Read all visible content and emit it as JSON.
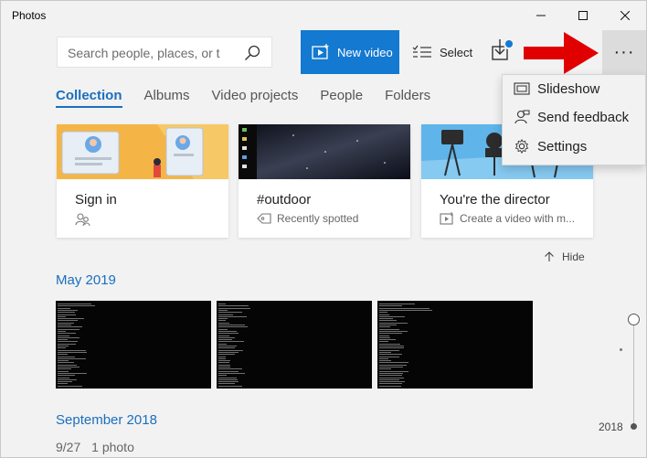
{
  "window": {
    "title": "Photos"
  },
  "toolbar": {
    "search_placeholder": "Search people, places, or t",
    "new_video_label": "New video",
    "select_label": "Select",
    "more_label": "···",
    "accent_color": "#1479d1"
  },
  "tabs": [
    {
      "label": "Collection",
      "active": true
    },
    {
      "label": "Albums",
      "active": false
    },
    {
      "label": "Video projects",
      "active": false
    },
    {
      "label": "People",
      "active": false
    },
    {
      "label": "Folders",
      "active": false
    }
  ],
  "cards": [
    {
      "title": "Sign in",
      "subtitle": "",
      "icon": "people-icon"
    },
    {
      "title": "#outdoor",
      "subtitle": "Recently spotted",
      "icon": "tag-icon"
    },
    {
      "title": "You're the director",
      "subtitle": "Create a video with m...",
      "icon": "video-create-icon"
    }
  ],
  "hide_label": "Hide",
  "sections": [
    {
      "title": "May 2019",
      "thumbnails": 3
    },
    {
      "title": "September 2018",
      "date": "9/27",
      "count": "1 photo"
    }
  ],
  "timeline": {
    "year": "2018"
  },
  "menu": {
    "items": [
      {
        "label": "Slideshow",
        "icon": "slideshow-icon"
      },
      {
        "label": "Send feedback",
        "icon": "feedback-icon"
      },
      {
        "label": "Settings",
        "icon": "gear-icon"
      }
    ]
  },
  "annotation": {
    "arrow_color": "#e00000"
  }
}
